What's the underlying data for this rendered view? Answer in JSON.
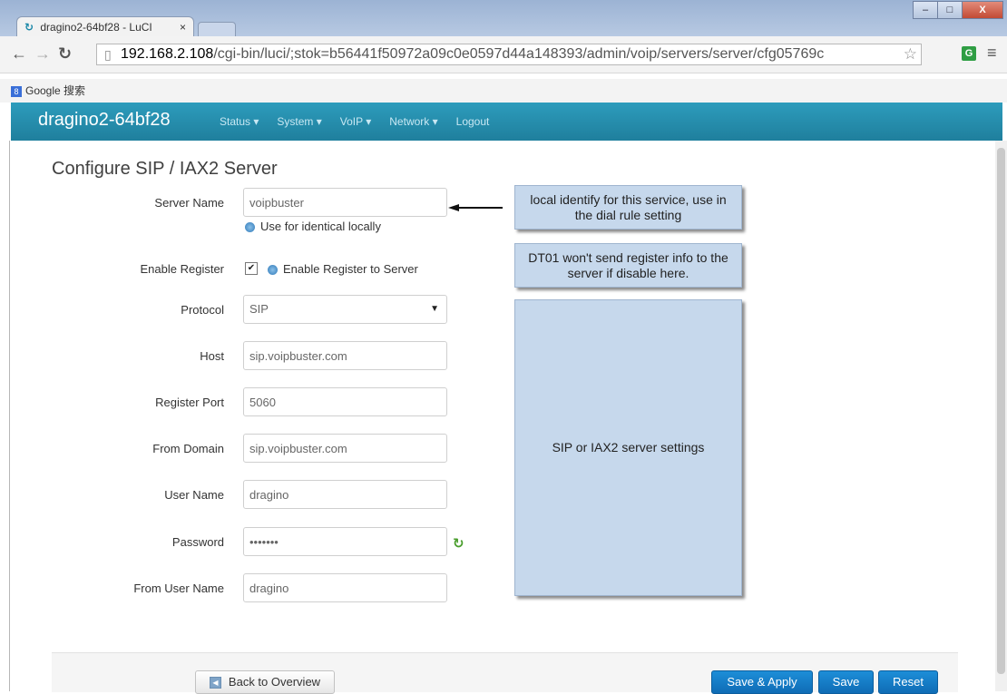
{
  "browser": {
    "tab_title": "dragino2-64bf28 - LuCI",
    "tab_close": "×",
    "url_host": "192.168.2.108",
    "url_path": "/cgi-bin/luci/;stok=b56441f50972a09c0e0597d44a148393/admin/voip/servers/server/cfg05769c",
    "bookmark": "Google 搜索",
    "win_controls": [
      "–",
      "□",
      "X"
    ]
  },
  "header": {
    "brand": "dragino2-64bf28",
    "nav": [
      "Status ▾",
      "System ▾",
      "VoIP ▾",
      "Network ▾",
      "Logout"
    ]
  },
  "page": {
    "title": "Configure SIP / IAX2 Server"
  },
  "form": {
    "server_name": {
      "label": "Server Name",
      "value": "voipbuster",
      "hint": "Use for identical locally"
    },
    "enable_register": {
      "label": "Enable Register",
      "checked": "✔",
      "hint": "Enable Register to Server"
    },
    "protocol": {
      "label": "Protocol",
      "value": "SIP",
      "arrow": "▼"
    },
    "host": {
      "label": "Host",
      "value": "sip.voipbuster.com"
    },
    "register_port": {
      "label": "Register Port",
      "value": "5060"
    },
    "from_domain": {
      "label": "From Domain",
      "value": "sip.voipbuster.com"
    },
    "user_name": {
      "label": "User Name",
      "value": "dragino"
    },
    "password": {
      "label": "Password",
      "value": "•••••••"
    },
    "from_user_name": {
      "label": "From User Name",
      "value": "dragino"
    }
  },
  "callouts": {
    "server_name": "local identify for this service, use in the dial rule setting",
    "register": "DT01 won't send register info to the server if disable here.",
    "settings": "SIP or IAX2 server settings"
  },
  "footer": {
    "back_label": "Back to Overview",
    "save_apply_label": "Save & Apply",
    "save_label": "Save",
    "reset_label": "Reset"
  },
  "colors": {
    "header": "#2590b0",
    "callout": "#c6d8ec",
    "primary_button": "#1579c4"
  }
}
